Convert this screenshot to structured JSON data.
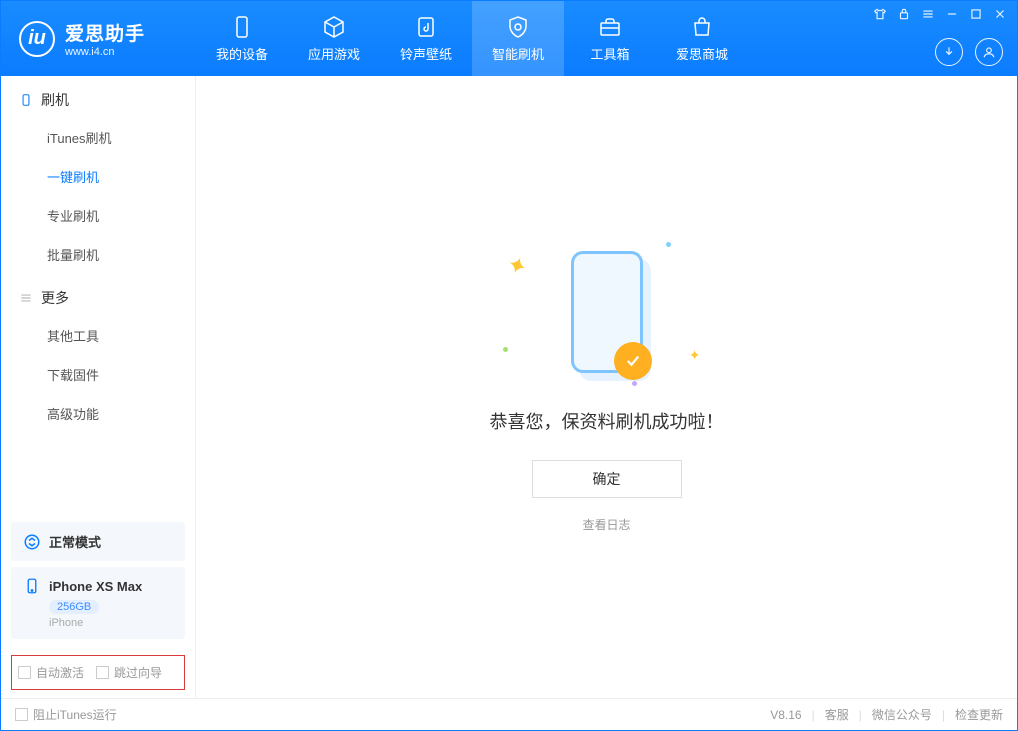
{
  "app": {
    "name": "爱思助手",
    "url": "www.i4.cn"
  },
  "nav": [
    {
      "label": "我的设备"
    },
    {
      "label": "应用游戏"
    },
    {
      "label": "铃声壁纸"
    },
    {
      "label": "智能刷机"
    },
    {
      "label": "工具箱"
    },
    {
      "label": "爱思商城"
    }
  ],
  "sidebar": {
    "section1": {
      "title": "刷机",
      "items": [
        "iTunes刷机",
        "一键刷机",
        "专业刷机",
        "批量刷机"
      ]
    },
    "section2": {
      "title": "更多",
      "items": [
        "其他工具",
        "下载固件",
        "高级功能"
      ]
    },
    "mode": "正常模式",
    "device": {
      "name": "iPhone XS Max",
      "storage": "256GB",
      "type": "iPhone"
    },
    "options": {
      "auto_activate": "自动激活",
      "skip_guide": "跳过向导"
    }
  },
  "main": {
    "success": "恭喜您，保资料刷机成功啦！",
    "ok": "确定",
    "view_log": "查看日志"
  },
  "footer": {
    "block_itunes": "阻止iTunes运行",
    "version": "V8.16",
    "service": "客服",
    "wechat": "微信公众号",
    "update": "检查更新"
  }
}
